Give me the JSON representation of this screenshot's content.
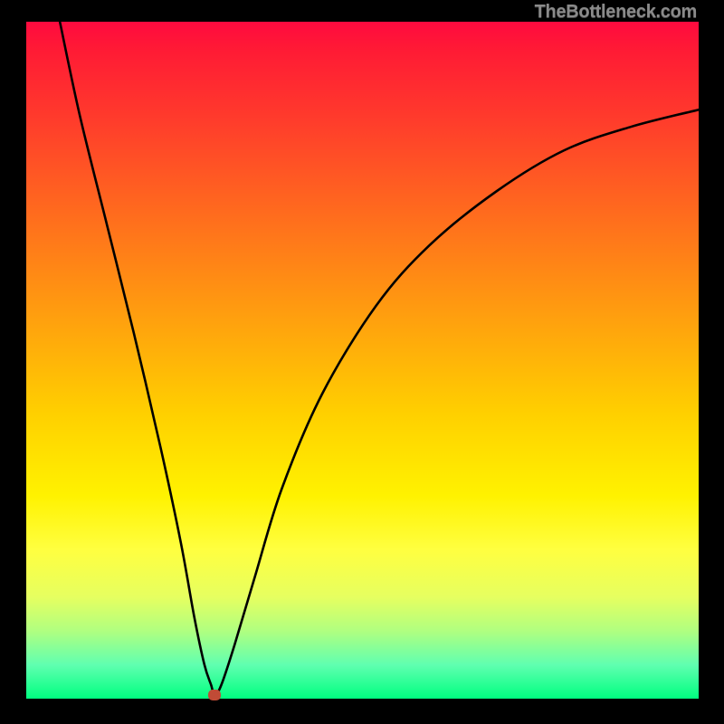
{
  "watermark": "TheBottleneck.com",
  "chart_data": {
    "type": "line",
    "title": "",
    "xlabel": "",
    "ylabel": "",
    "xlim": [
      0,
      100
    ],
    "ylim": [
      0,
      100
    ],
    "grid": false,
    "legend": false,
    "background_gradient": [
      "#ff0a3f",
      "#ff8c14",
      "#fff200",
      "#00ff80"
    ],
    "series": [
      {
        "name": "curve",
        "x": [
          5,
          8,
          12,
          16,
          20,
          23,
          25,
          26.5,
          27.5,
          28,
          29,
          31,
          34,
          38,
          44,
          52,
          60,
          70,
          80,
          90,
          100
        ],
        "values": [
          100,
          86,
          70,
          54,
          37,
          23,
          12,
          5,
          2,
          0.5,
          2,
          8,
          18,
          31,
          45,
          58,
          67,
          75,
          81,
          84.5,
          87
        ]
      }
    ],
    "annotations": [
      {
        "name": "marker",
        "x": 28,
        "y": 0.5,
        "color": "#c04b36"
      }
    ]
  }
}
